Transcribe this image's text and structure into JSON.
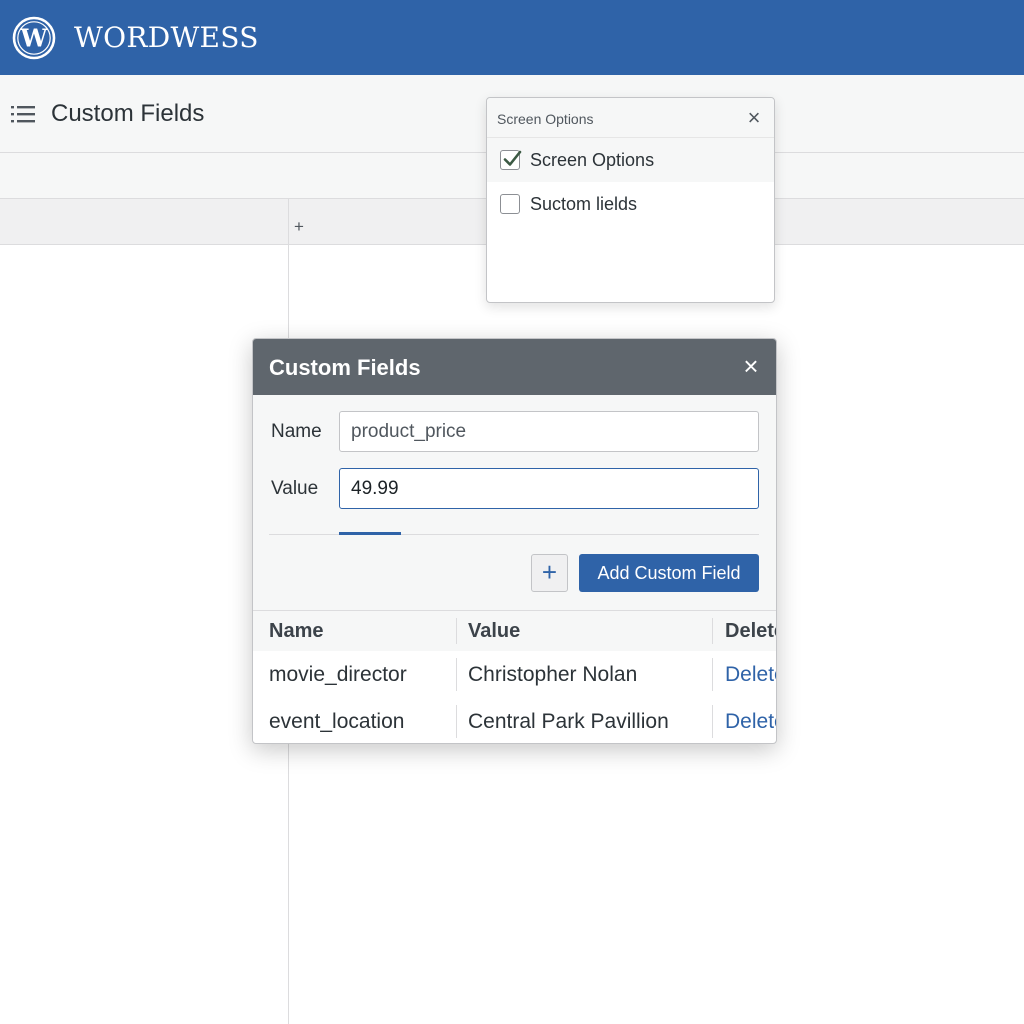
{
  "topbar": {
    "logo_icon": "wordpress-logo-icon",
    "brand": "WORDWESS",
    "color": "#2f63a8"
  },
  "page_header": {
    "menu_icon": "list-icon",
    "title": "Custom Fields"
  },
  "column_bar": {
    "plus": "+"
  },
  "screen_options": {
    "title": "Screen Options",
    "close": "×",
    "options": [
      {
        "label": "Screen Options",
        "checked": true
      },
      {
        "label": "Suctom lields",
        "checked": false
      }
    ]
  },
  "modal": {
    "title": "Custom Fields",
    "close": "×",
    "header_color": "#5f666d",
    "name_label": "Name",
    "name_value": "product_price",
    "value_label": "Value",
    "value_value": "49.99",
    "plus_button": "+",
    "add_button": "Add Custom Field"
  },
  "table": {
    "headers": [
      "Name",
      "Value",
      "Delete"
    ],
    "rows": [
      {
        "name": "movie_director",
        "value": "Christopher Nolan",
        "action": "Delete"
      },
      {
        "name": "event_location",
        "value": "Central Park Pavillion",
        "action": "Delete"
      }
    ]
  }
}
